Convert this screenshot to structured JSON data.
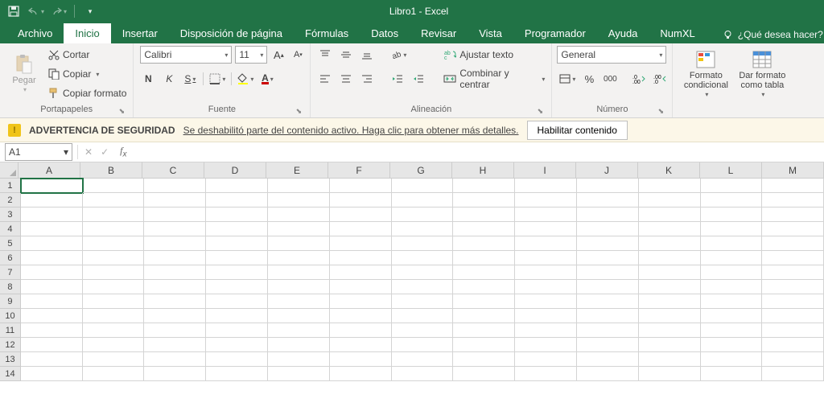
{
  "title": "Libro1 - Excel",
  "tabs": [
    "Archivo",
    "Inicio",
    "Insertar",
    "Disposición de página",
    "Fórmulas",
    "Datos",
    "Revisar",
    "Vista",
    "Programador",
    "Ayuda",
    "NumXL"
  ],
  "active_tab": "Inicio",
  "help_placeholder": "¿Qué desea hacer?",
  "clipboard": {
    "paste": "Pegar",
    "cut": "Cortar",
    "copy": "Copiar",
    "fmtpainter": "Copiar formato",
    "label": "Portapapeles"
  },
  "font": {
    "name": "Calibri",
    "size": "11",
    "label": "Fuente",
    "bold": "N",
    "italic": "K",
    "underline": "S"
  },
  "alignment": {
    "label": "Alineación",
    "wrap": "Ajustar texto",
    "merge": "Combinar y centrar"
  },
  "number": {
    "label": "Número",
    "format": "General",
    "percent": "%",
    "thousands": "000"
  },
  "styles": {
    "condfmt": "Formato condicional",
    "astable": "Dar formato como tabla"
  },
  "security": {
    "title": "ADVERTENCIA DE SEGURIDAD",
    "msg": "Se deshabilitó parte del contenido activo. Haga clic para obtener más detalles.",
    "enable": "Habilitar contenido"
  },
  "namebox": "A1",
  "columns": [
    "A",
    "B",
    "C",
    "D",
    "E",
    "F",
    "G",
    "H",
    "I",
    "J",
    "K",
    "L",
    "M"
  ],
  "rows": [
    "1",
    "2",
    "3",
    "4",
    "5",
    "6",
    "7",
    "8",
    "9",
    "10",
    "11",
    "12",
    "13",
    "14"
  ]
}
